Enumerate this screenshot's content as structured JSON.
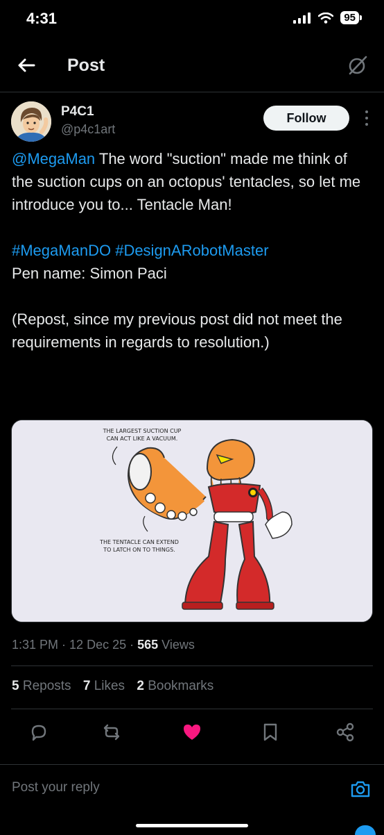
{
  "status_bar": {
    "time": "4:31",
    "battery": "95"
  },
  "header": {
    "title": "Post"
  },
  "author": {
    "name": "P4C1",
    "handle": "@p4c1art",
    "follow_label": "Follow"
  },
  "post": {
    "mention": "@MegaMan",
    "line1_rest": " The word \"suction\" made me think of the suction cups on an octopus' tentacles, so let me introduce you to... Tentacle Man!",
    "hashtag1": "#MegaManDO",
    "hashtag2": "#DesignARobotMaster",
    "pen_name": "Pen name: Simon Paci",
    "repost_note": "(Repost, since my previous post did not meet the requirements in regards to resolution.)"
  },
  "image": {
    "caption_top_1": "THE LARGEST SUCTION CUP",
    "caption_top_2": "CAN ACT LIKE A VACUUM.",
    "caption_bottom_1": "THE TENTACLE CAN EXTEND",
    "caption_bottom_2": "TO LATCH ON TO THINGS."
  },
  "meta": {
    "time": "1:31 PM",
    "sep1": " · ",
    "date": "12 Dec 25",
    "sep2": " · ",
    "views_count": "565",
    "views_label": " Views"
  },
  "stats": {
    "reposts_count": "5",
    "reposts_label": " Reposts",
    "likes_count": "7",
    "likes_label": " Likes",
    "bookmarks_count": "2",
    "bookmarks_label": " Bookmarks"
  },
  "reply": {
    "placeholder": "Post your reply"
  },
  "colors": {
    "accent": "#1d9bf0",
    "like": "#f91880",
    "muted": "#71767b",
    "background": "#000000"
  },
  "icons": [
    "back-arrow-icon",
    "grok-icon",
    "more-vertical-icon",
    "reply-icon",
    "repost-icon",
    "heart-icon",
    "bookmark-icon",
    "share-icon",
    "camera-icon"
  ]
}
